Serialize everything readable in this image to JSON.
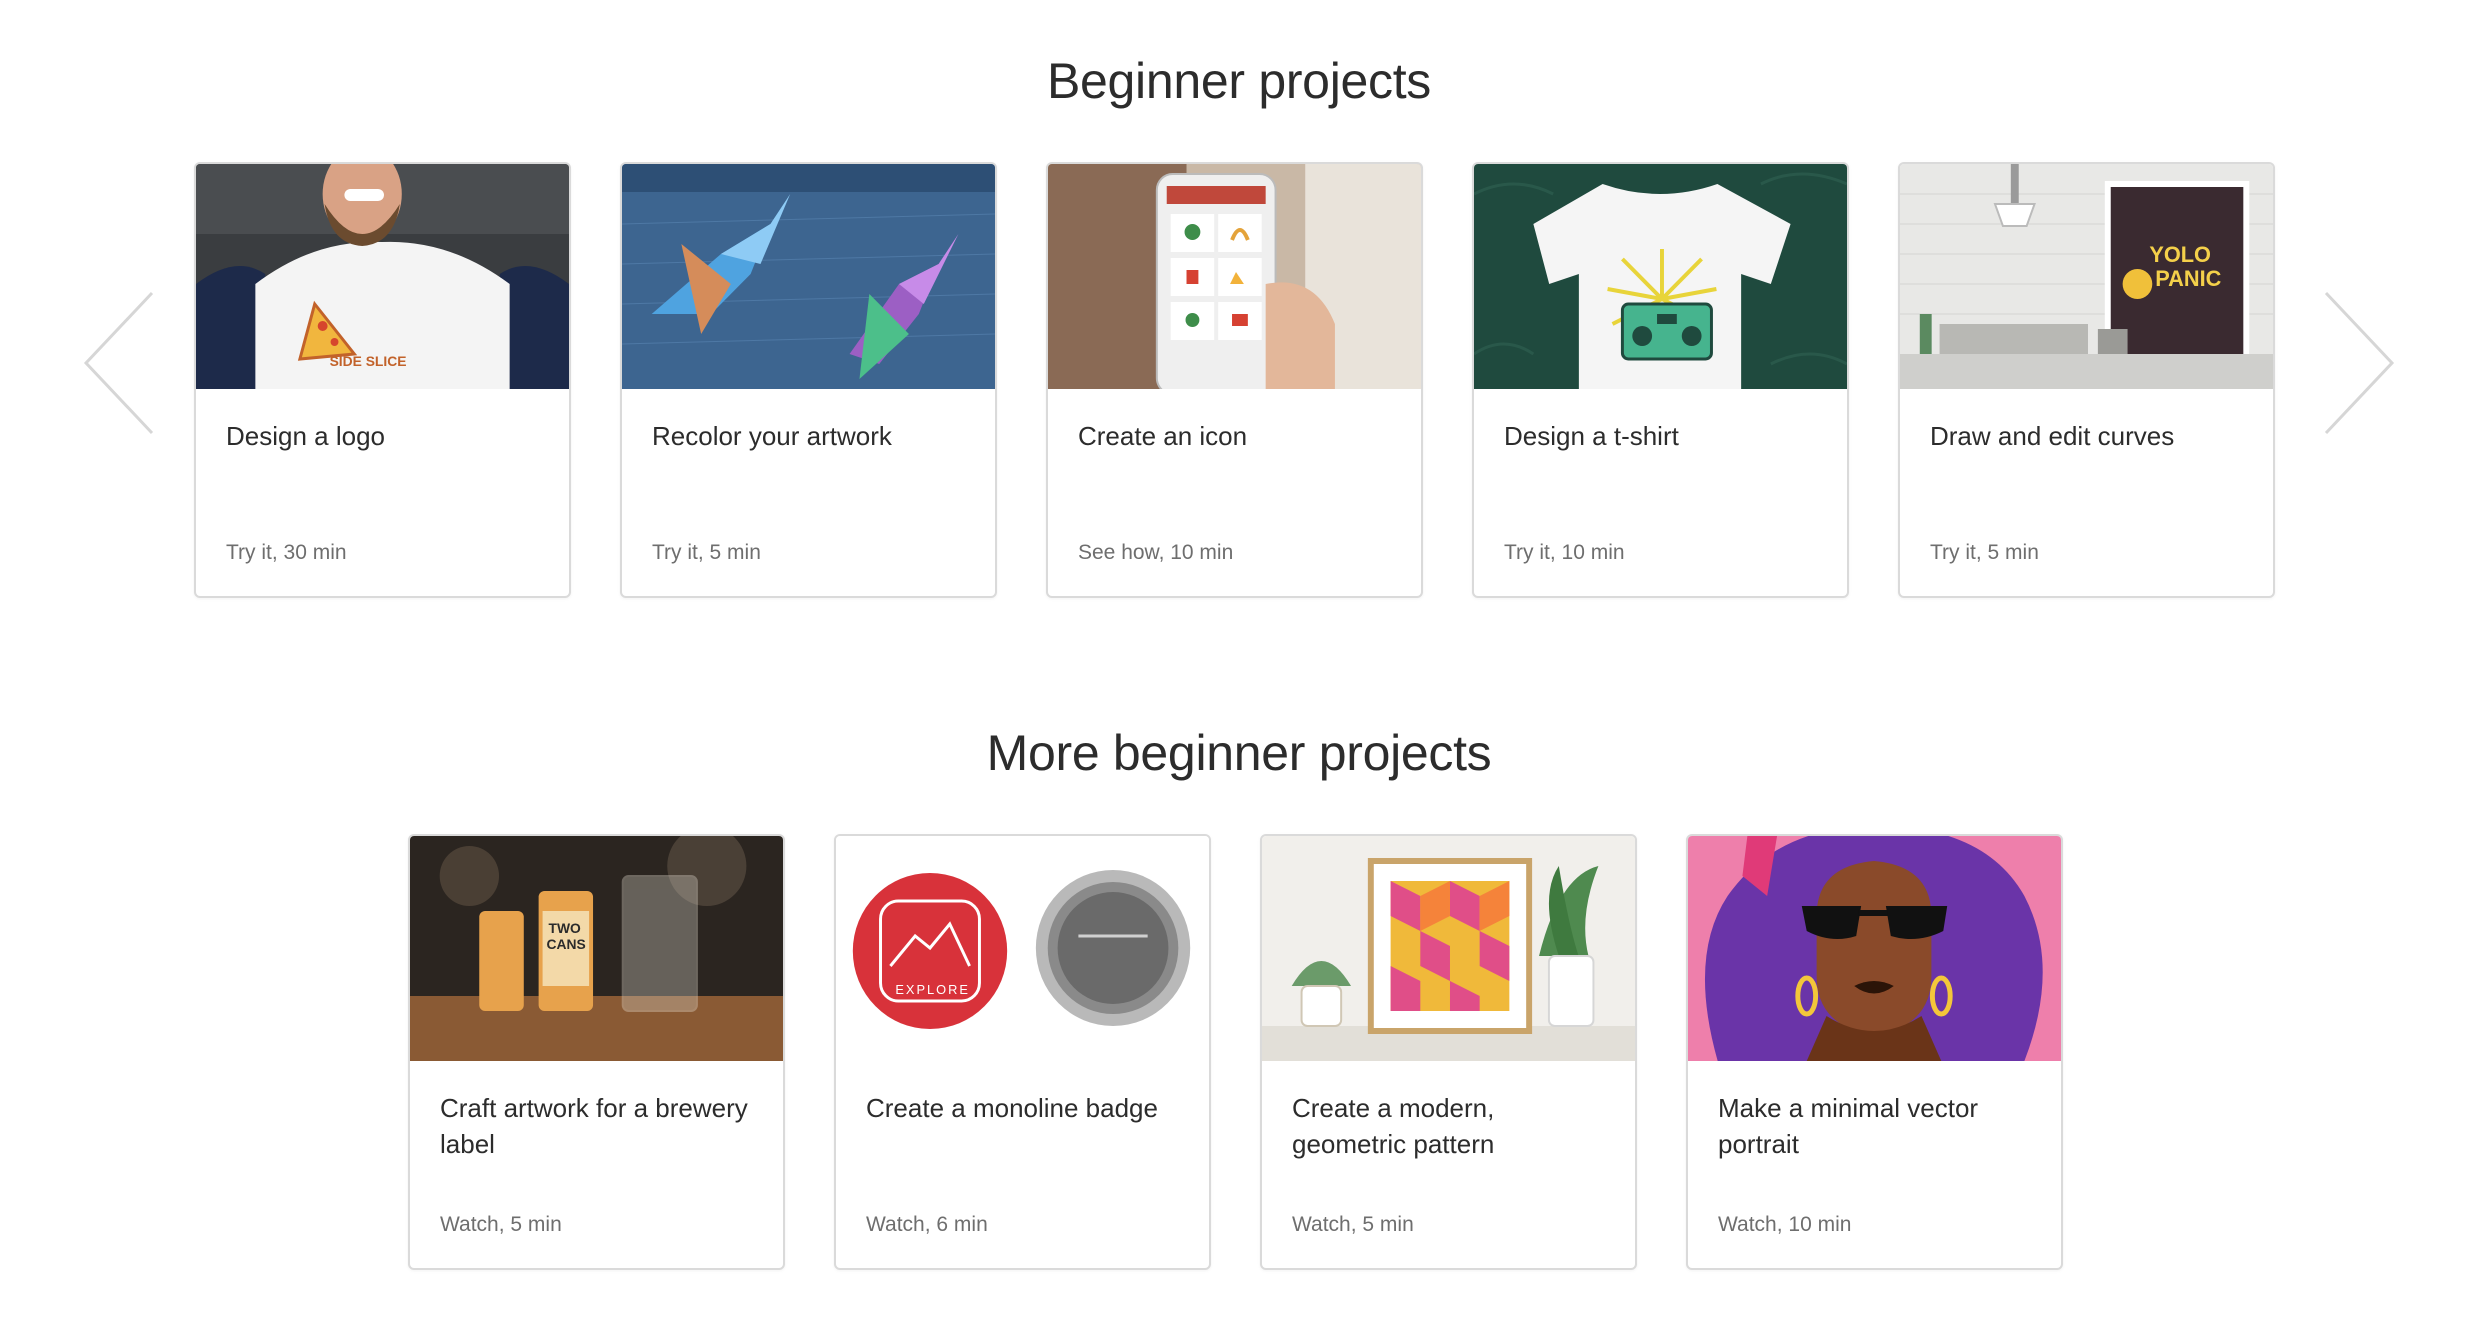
{
  "section1": {
    "title": "Beginner projects",
    "cards": [
      {
        "title": "Design a logo",
        "meta": "Try it, 30 min",
        "thumb_text": "SIDE SLICE"
      },
      {
        "title": "Recolor your artwork",
        "meta": "Try it, 5 min"
      },
      {
        "title": "Create an icon",
        "meta": "See how, 10 min"
      },
      {
        "title": "Design a t-shirt",
        "meta": "Try it, 10 min"
      },
      {
        "title": "Draw and edit curves",
        "meta": "Try it, 5 min",
        "thumb_text_1": "YOLO",
        "thumb_text_2": "PANIC"
      }
    ]
  },
  "section2": {
    "title": "More beginner projects",
    "cards": [
      {
        "title": "Craft artwork for a brewery label",
        "meta": "Watch, 5 min",
        "thumb_text_1": "TWO",
        "thumb_text_2": "CANS"
      },
      {
        "title": "Create a monoline badge",
        "meta": "Watch, 6 min",
        "thumb_text": "EXPLORE"
      },
      {
        "title": "Create a modern, geometric pattern",
        "meta": "Watch, 5 min"
      },
      {
        "title": "Make a minimal vector portrait",
        "meta": "Watch, 10 min"
      }
    ]
  },
  "navigation": {
    "prev_icon": "chevron-left-icon",
    "next_icon": "chevron-right-icon"
  },
  "colors": {
    "card_border": "#dadada",
    "title_text": "#2c2c2c",
    "meta_text": "#6e6e6e",
    "arrow": "#d6d6d6"
  }
}
